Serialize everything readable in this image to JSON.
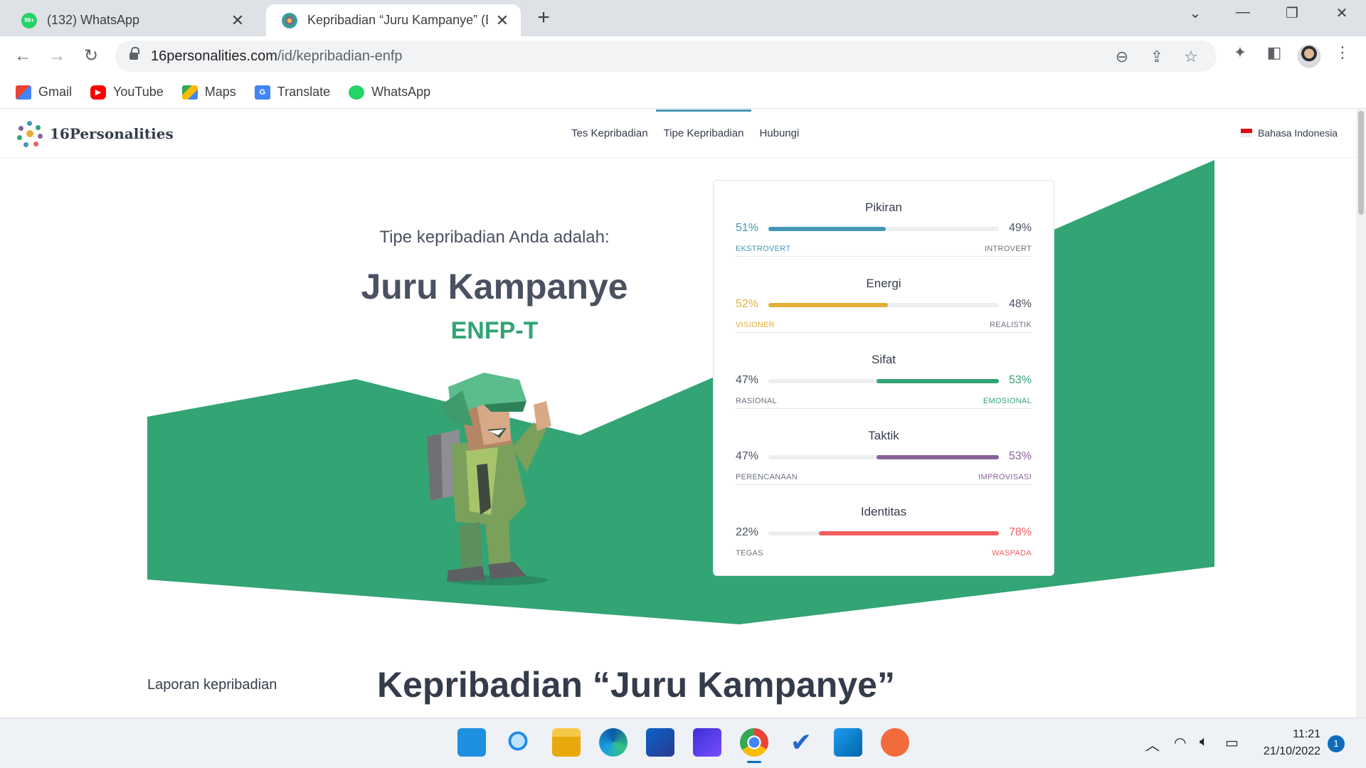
{
  "browser": {
    "tabs": [
      {
        "title": "(132) WhatsApp",
        "favicon": "whatsapp-icon",
        "active": false
      },
      {
        "title": "Kepribadian “Juru Kampanye” (EN",
        "favicon": "16personalities-icon",
        "active": true
      }
    ],
    "url": {
      "domain": "16personalities.com",
      "path": "/id/kepribadian-enfp"
    },
    "bookmarks": [
      {
        "label": "Gmail",
        "icon": "gmail-icon"
      },
      {
        "label": "YouTube",
        "icon": "youtube-icon"
      },
      {
        "label": "Maps",
        "icon": "maps-icon"
      },
      {
        "label": "Translate",
        "icon": "translate-icon"
      },
      {
        "label": "WhatsApp",
        "icon": "whatsapp-icon"
      }
    ],
    "wa_badge": "99+"
  },
  "site": {
    "logo": "16Personalities",
    "nav": [
      "Tes Kepribadian",
      "Tipe Kepribadian",
      "Hubungi"
    ],
    "active_nav": "Tipe Kepribadian",
    "language": "Bahasa Indonesia"
  },
  "hero": {
    "subtitle": "Tipe kepribadian Anda adalah:",
    "type_name": "Juru Kampanye",
    "type_code": "ENFP-T"
  },
  "traits": [
    {
      "name": "Pikiran",
      "left_pct": "51%",
      "right_pct": "49%",
      "left_label": "EKSTROVERT",
      "right_label": "INTROVERT",
      "dominant": "left",
      "value": 51,
      "color": "#4298b4"
    },
    {
      "name": "Energi",
      "left_pct": "52%",
      "right_pct": "48%",
      "left_label": "VISIONER",
      "right_label": "REALISTIK",
      "dominant": "left",
      "value": 52,
      "color": "#e4ae3a"
    },
    {
      "name": "Sifat",
      "left_pct": "47%",
      "right_pct": "53%",
      "left_label": "RASIONAL",
      "right_label": "EMOSIONAL",
      "dominant": "right",
      "value": 53,
      "color": "#33a474"
    },
    {
      "name": "Taktik",
      "left_pct": "47%",
      "right_pct": "53%",
      "left_label": "PERENCANAAN",
      "right_label": "IMPROVISASI",
      "dominant": "right",
      "value": 53,
      "color": "#88619a"
    },
    {
      "name": "Identitas",
      "left_pct": "22%",
      "right_pct": "78%",
      "left_label": "TEGAS",
      "right_label": "WASPADA",
      "dominant": "right",
      "value": 78,
      "color": "#f25e62"
    }
  ],
  "report": {
    "label": "Laporan kepribadian",
    "title": "Kepribadian “Juru Kampanye”"
  },
  "colors": {
    "hero_green": "#33a474"
  },
  "taskbar": {
    "apps": [
      "windows-start-icon",
      "search-icon",
      "file-explorer-icon",
      "edge-icon",
      "store-icon",
      "app-icon",
      "chrome-icon",
      "todo-icon",
      "vscode-icon",
      "app-orange-icon"
    ],
    "time": "11:21",
    "date": "21/10/2022",
    "notifications": "1"
  }
}
